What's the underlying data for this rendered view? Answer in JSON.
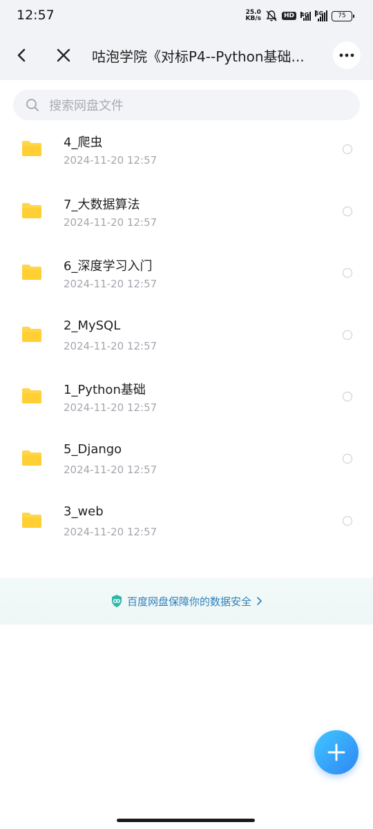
{
  "status_bar": {
    "time": "12:57",
    "net_speed_value": "25.0",
    "net_speed_unit": "KB/s",
    "hd_label": "HD",
    "signal1_label": "4G",
    "signal2_label": "5G",
    "battery": "75"
  },
  "header": {
    "title": "咕泡学院《对标P4--Python基础..."
  },
  "search": {
    "placeholder": "搜索网盘文件"
  },
  "files": [
    {
      "name": "4_爬虫",
      "date": "2024-11-20  12:57"
    },
    {
      "name": "7_大数据算法",
      "date": "2024-11-20  12:57"
    },
    {
      "name": "6_深度学习入门",
      "date": "2024-11-20  12:57"
    },
    {
      "name": "2_MySQL",
      "date": "2024-11-20  12:57"
    },
    {
      "name": "1_Python基础",
      "date": "2024-11-20  12:57"
    },
    {
      "name": "5_Django",
      "date": "2024-11-20  12:57"
    },
    {
      "name": "3_web",
      "date": "2024-11-20  12:57"
    }
  ],
  "banner": {
    "text": "百度网盘保障你的数据安全"
  },
  "icons": {
    "back": "arrow-left-icon",
    "close": "close-icon",
    "more": "more-horizontal-icon",
    "search": "search-icon",
    "folder": "folder-icon",
    "shield": "shield-icon",
    "add": "plus-icon"
  },
  "colors": {
    "folder": "#ffd54a",
    "accent": "#2e86f5",
    "banner_text": "#2f7fb8"
  }
}
